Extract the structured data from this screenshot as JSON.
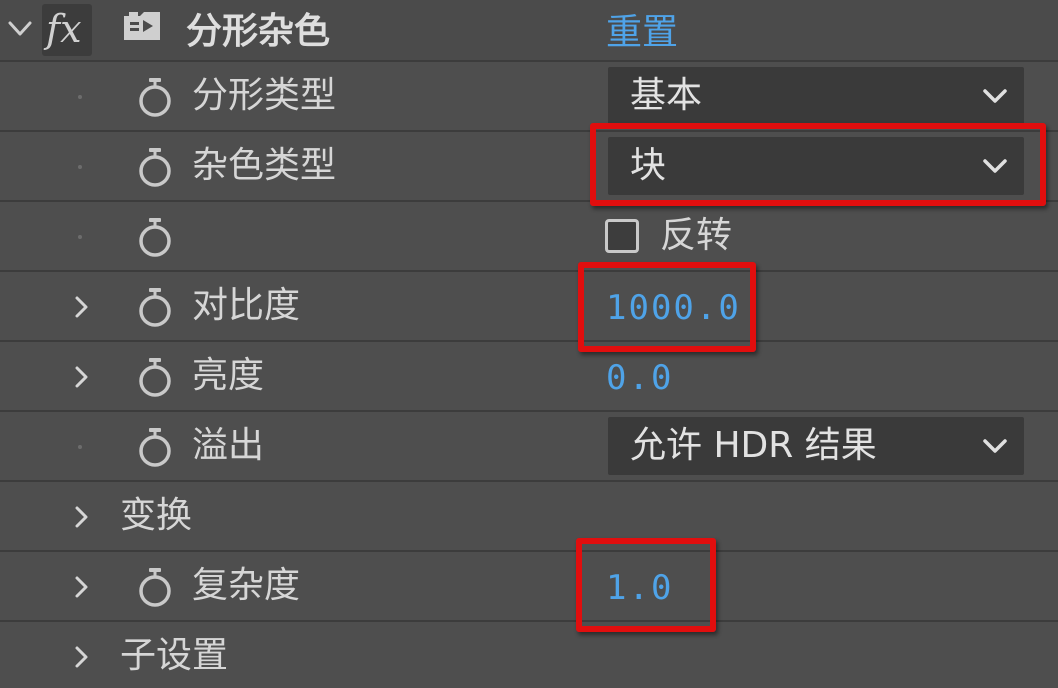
{
  "effect": {
    "title": "分形杂色",
    "fx_label": "fx",
    "reset_label": "重置",
    "expanded": true,
    "icons": {
      "collapse": "chevron-down-icon",
      "fx": "fx-icon",
      "effect_preset": "effect-preset-icon"
    }
  },
  "properties": [
    {
      "id": "fractal-type",
      "label": "分形类型",
      "control": "dropdown",
      "value": "基本",
      "has_stopwatch": true,
      "expandable": false
    },
    {
      "id": "noise-type",
      "label": "杂色类型",
      "control": "dropdown",
      "value": "块",
      "has_stopwatch": true,
      "expandable": false,
      "highlighted": true
    },
    {
      "id": "invert",
      "label": "",
      "control": "checkbox",
      "value": "反转",
      "checked": false,
      "has_stopwatch": true,
      "expandable": false
    },
    {
      "id": "contrast",
      "label": "对比度",
      "control": "number",
      "value": "1000.0",
      "has_stopwatch": true,
      "expandable": true,
      "highlighted": true
    },
    {
      "id": "brightness",
      "label": "亮度",
      "control": "number",
      "value": "0.0",
      "has_stopwatch": true,
      "expandable": true
    },
    {
      "id": "overflow",
      "label": "溢出",
      "control": "dropdown",
      "value": "允许 HDR 结果",
      "has_stopwatch": true,
      "expandable": false
    },
    {
      "id": "transform",
      "label": "变换",
      "control": "group",
      "has_stopwatch": false,
      "expandable": true
    },
    {
      "id": "complexity",
      "label": "复杂度",
      "control": "number",
      "value": "1.0",
      "has_stopwatch": true,
      "expandable": true,
      "highlighted": true
    },
    {
      "id": "sub-settings",
      "label": "子设置",
      "control": "group",
      "has_stopwatch": false,
      "expandable": true
    }
  ],
  "colors": {
    "panel_bg": "#4e4e4e",
    "row_divider": "#3c3c3c",
    "value_blue": "#4fa3e8",
    "dropdown_bg": "#3a3a3a",
    "highlight_red": "#e10e0e",
    "label_text": "#d6d6d6"
  }
}
